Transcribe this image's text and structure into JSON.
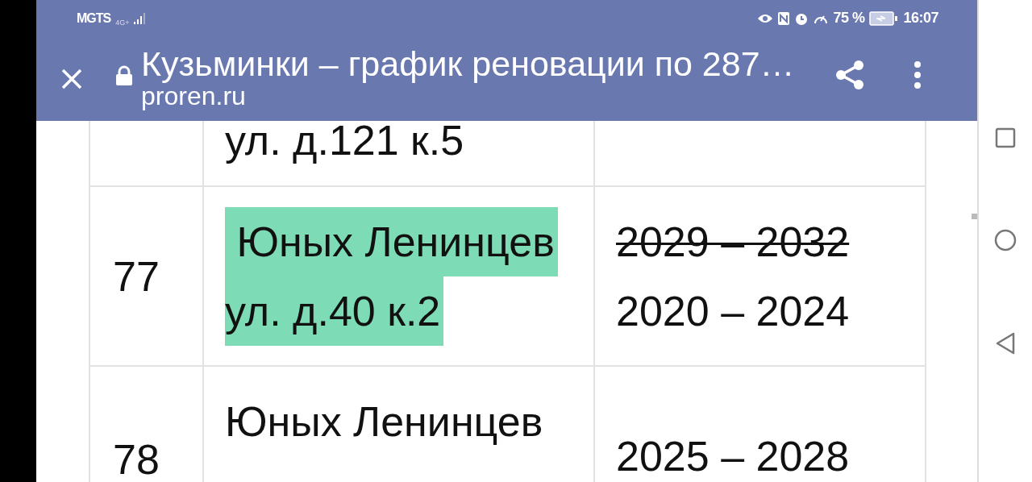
{
  "status_bar": {
    "carrier": "MGTS",
    "network": "4G+",
    "battery": "75 %",
    "time": "16:07"
  },
  "browser_bar": {
    "title": "Кузьминки – график реновации по 287…",
    "url": "proren.ru"
  },
  "table": {
    "rows": [
      {
        "number": "",
        "address": [
          {
            "text": "ул. д.121 к.5",
            "highlighted": false
          }
        ],
        "years": []
      },
      {
        "number": "77",
        "address": [
          {
            "text": " Юных Ленинцев",
            "highlighted": true
          },
          {
            "text": "ул. д.40 к.2",
            "highlighted": true
          }
        ],
        "years": [
          {
            "text": "2029 – 2032",
            "struck": true
          },
          {
            "text": "2020 – 2024",
            "struck": false
          }
        ]
      },
      {
        "number": "78",
        "address": [
          {
            "text": "Юных Ленинцев",
            "highlighted": false
          }
        ],
        "years": [
          {
            "text": "2025 – 2028",
            "struck": false
          }
        ]
      }
    ]
  }
}
